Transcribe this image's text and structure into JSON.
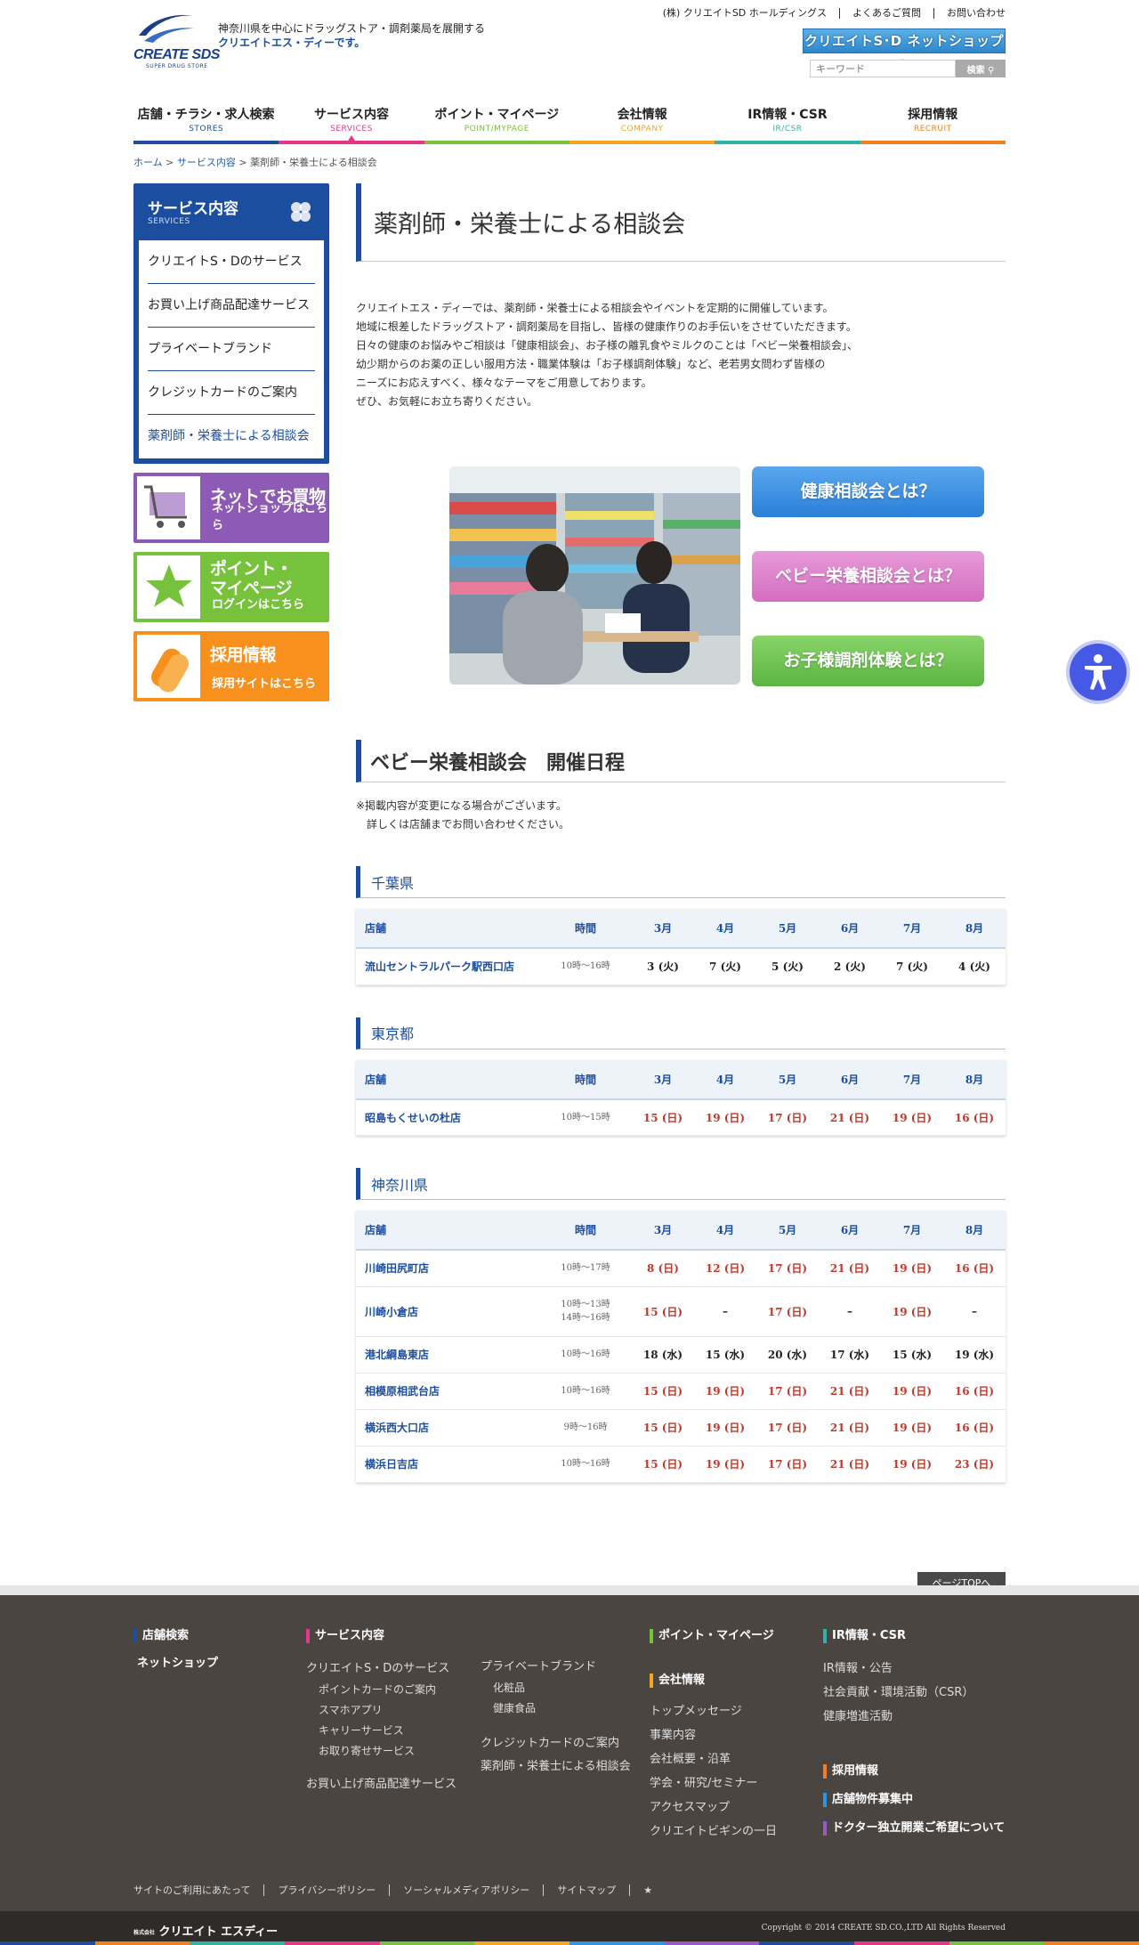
{
  "header": {
    "logo_text": "CREATE SDS",
    "logo_sub": "SUPER DRUG STORE",
    "tagline_line1": "神奈川県を中心にドラッグストア・調剤薬局を展開する",
    "tagline_line2": "クリエイトエス・ディーです。",
    "toplinks": [
      "(株) クリエイトSD ホールディングス",
      "よくあるご質問",
      "お問い合わせ"
    ],
    "netshop_label": "クリエイトS･D ネットショップ へ",
    "search_placeholder": "キーワード",
    "search_button": "検索"
  },
  "nav": [
    {
      "jp": "店舗・チラシ・求人検索",
      "en": "STORES",
      "color": "#1c4ea0"
    },
    {
      "jp": "サービス内容",
      "en": "SERVICES",
      "color": "#e4378a"
    },
    {
      "jp": "ポイント・マイページ",
      "en": "POINT/MYPAGE",
      "color": "#77c23c"
    },
    {
      "jp": "会社情報",
      "en": "COMPANY",
      "color": "#f5a623"
    },
    {
      "jp": "IR情報・CSR",
      "en": "IR/CSR",
      "color": "#2fb3a5"
    },
    {
      "jp": "採用情報",
      "en": "RECRUIT",
      "color": "#f07f1c"
    }
  ],
  "breadcrumb": {
    "home": "ホーム",
    "services": "サービス内容",
    "current": "薬剤師・栄養士による相談会"
  },
  "sidebar": {
    "title": "サービス内容",
    "title_en": "SERVICES",
    "items": [
      "クリエイトS・Dのサービス",
      "お買い上げ商品配達サービス",
      "プライベートブランド",
      "クレジットカードのご案内",
      "薬剤師・栄養士による相談会"
    ],
    "banners": [
      {
        "t1": "ネットでお買物",
        "t2": "ネットショップはこちら"
      },
      {
        "t1a": "ポイント・",
        "t1b": "マイページ",
        "t2": "ログインはこちら"
      },
      {
        "t1": "採用情報",
        "t2": "採用サイトはこちら"
      }
    ]
  },
  "main": {
    "title": "薬剤師・栄養士による相談会",
    "intro": [
      "クリエイトエス・ディーでは、薬剤師・栄養士による相談会やイベントを定期的に開催しています。",
      "地域に根差したドラッグストア・調剤薬局を目指し、皆様の健康作りのお手伝いをさせていただきます。",
      "日々の健康のお悩みやご相談は「健康相談会」、お子様の離乳食やミルクのことは「ベビー栄養相談会」、",
      "幼少期からのお薬の正しい服用方法・職業体験は「お子様調剤体験」など、老若男女問わず皆様の",
      "ニーズにお応えすべく、様々なテーマをご用意しております。",
      "ぜひ、お気軽にお立ち寄りください。"
    ],
    "promo_buttons": [
      "健康相談会とは？",
      "ベビー栄養相談会とは？",
      "お子様調剤体験とは？"
    ],
    "schedule_title": "ベビー栄養相談会　開催日程",
    "note1": "※掲載内容が変更になる場合がございます。",
    "note2": "詳しくは店舗までお問い合わせください。",
    "table_headers": [
      "店舗",
      "時間",
      "3月",
      "4月",
      "5月",
      "6月",
      "7月",
      "8月"
    ],
    "prefectures": [
      {
        "name": "千葉県",
        "rows": [
          {
            "store": "流山セントラルパーク駅西口店",
            "time": [
              "10時～16時"
            ],
            "dates": [
              "3 (火)",
              "7 (火)",
              "5 (火)",
              "2 (火)",
              "7 (火)",
              "4 (火)"
            ],
            "red": false
          }
        ]
      },
      {
        "name": "東京都",
        "rows": [
          {
            "store": "昭島もくせいの杜店",
            "time": [
              "10時～15時"
            ],
            "dates": [
              "15 (日)",
              "19 (日)",
              "17 (日)",
              "21 (日)",
              "19 (日)",
              "16 (日)"
            ],
            "red": true
          }
        ]
      },
      {
        "name": "神奈川県",
        "rows": [
          {
            "store": "川崎田尻町店",
            "time": [
              "10時～17時"
            ],
            "dates": [
              "8 (日)",
              "12 (日)",
              "17 (日)",
              "21 (日)",
              "19 (日)",
              "16 (日)"
            ],
            "red": true
          },
          {
            "store": "川崎小倉店",
            "time": [
              "10時～13時",
              "14時～16時"
            ],
            "dates": [
              "15 (日)",
              "–",
              "17 (日)",
              "–",
              "19 (日)",
              "–"
            ],
            "red": true
          },
          {
            "store": "港北綱島東店",
            "time": [
              "10時～16時"
            ],
            "dates": [
              "18 (水)",
              "15 (水)",
              "20 (水)",
              "17 (水)",
              "15 (水)",
              "19 (水)"
            ],
            "red": false
          },
          {
            "store": "相模原相武台店",
            "time": [
              "10時～16時"
            ],
            "dates": [
              "15 (日)",
              "19 (日)",
              "17 (日)",
              "21 (日)",
              "19 (日)",
              "16 (日)"
            ],
            "red": true
          },
          {
            "store": "横浜西大口店",
            "time": [
              "9時～16時"
            ],
            "dates": [
              "15 (日)",
              "19 (日)",
              "17 (日)",
              "21 (日)",
              "19 (日)",
              "16 (日)"
            ],
            "red": true
          },
          {
            "store": "横浜日吉店",
            "time": [
              "10時～16時"
            ],
            "dates": [
              "15 (日)",
              "19 (日)",
              "17 (日)",
              "21 (日)",
              "19 (日)",
              "23 (日)"
            ],
            "red": true
          }
        ]
      }
    ]
  },
  "pagetop": "ページTOPへ",
  "footer": {
    "stores_h": "店舗検索",
    "netshop": "ネットショップ",
    "services_h": "サービス内容",
    "svc1": "クリエイトS・Dのサービス",
    "svc1_subs": [
      "ポイントカードのご案内",
      "スマホアプリ",
      "キャリーサービス",
      "お取り寄せサービス"
    ],
    "svc2": "お買い上げ商品配達サービス",
    "pb": "プライベートブランド",
    "pb_subs": [
      "化粧品",
      "健康食品"
    ],
    "credit": "クレジットカードのご案内",
    "consult": "薬剤師・栄養士による相談会",
    "point_h": "ポイント・マイページ",
    "company_h": "会社情報",
    "company_items": [
      "トップメッセージ",
      "事業内容",
      "会社概要・沿革",
      "学会・研究/セミナー",
      "アクセスマップ",
      "クリエイトビギンの一日"
    ],
    "ir_h": "IR情報・CSR",
    "ir_items": [
      "IR情報・公告",
      "社会貢献・環境活動（CSR）",
      "健康増進活動"
    ],
    "recruit_h": "採用情報",
    "property_h": "店舗物件募集中",
    "doctor_h": "ドクター独立開業ご希望について",
    "bottom_links": [
      "サイトのご利用にあたって",
      "プライバシーポリシー",
      "ソーシャルメディアポリシー",
      "サイトマップ"
    ],
    "bottom_icon": "★",
    "copyright": "Copyright © 2014 CREATE SD.CO.,LTD All Rights Reserved",
    "logo": "クリエイト エスディー",
    "logo_small": "株式会社"
  }
}
